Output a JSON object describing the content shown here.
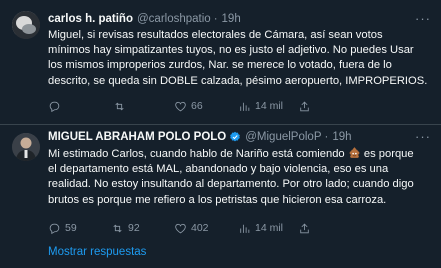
{
  "tweets": [
    {
      "name": "carlos h. patiño",
      "handle": "@carloshpatio",
      "dot": "·",
      "time": "19h",
      "text": "Miguel, si revisas resultados electorales de Cámara, así  sean votos\nmínimos hay simpatizantes tuyos, no es justo el adjetivo. No puedes Usar\nlos mismos improperios zurdos, Nar. se merece lo votado, fuera de lo\ndescrito, se queda sin DOBLE calzada, pésimo aeropuerto, IMPROPERIOS.",
      "replies": "",
      "retweets": "",
      "likes": "66",
      "views": "14 mil",
      "verified": false
    },
    {
      "name": "MIGUEL ABRAHAM POLO POLO",
      "handle": "@MiguelPoloP",
      "dot": "·",
      "time": "19h",
      "text_part1": "Mi estimado Carlos, cuando hablo de Nariño está comiendo ",
      "text_part2": " es porque\nel departamento está MAL, abandonado y bajo violencia, eso es una\nrealidad. No estoy insultando al departamento. Por otro lado; cuando digo\nbrutos es porque me refiero a los petristas que hicieron esa carroza.",
      "replies": "59",
      "retweets": "92",
      "likes": "402",
      "views": "14 mil",
      "verified": true
    }
  ],
  "more_glyph": "···",
  "show_more_replies": "Mostrar respuestas",
  "colors": {
    "background": "#15202b",
    "text": "#f7f9f9",
    "muted": "#8b98a5",
    "accent": "#1d9bf0",
    "divider": "#38444d"
  }
}
